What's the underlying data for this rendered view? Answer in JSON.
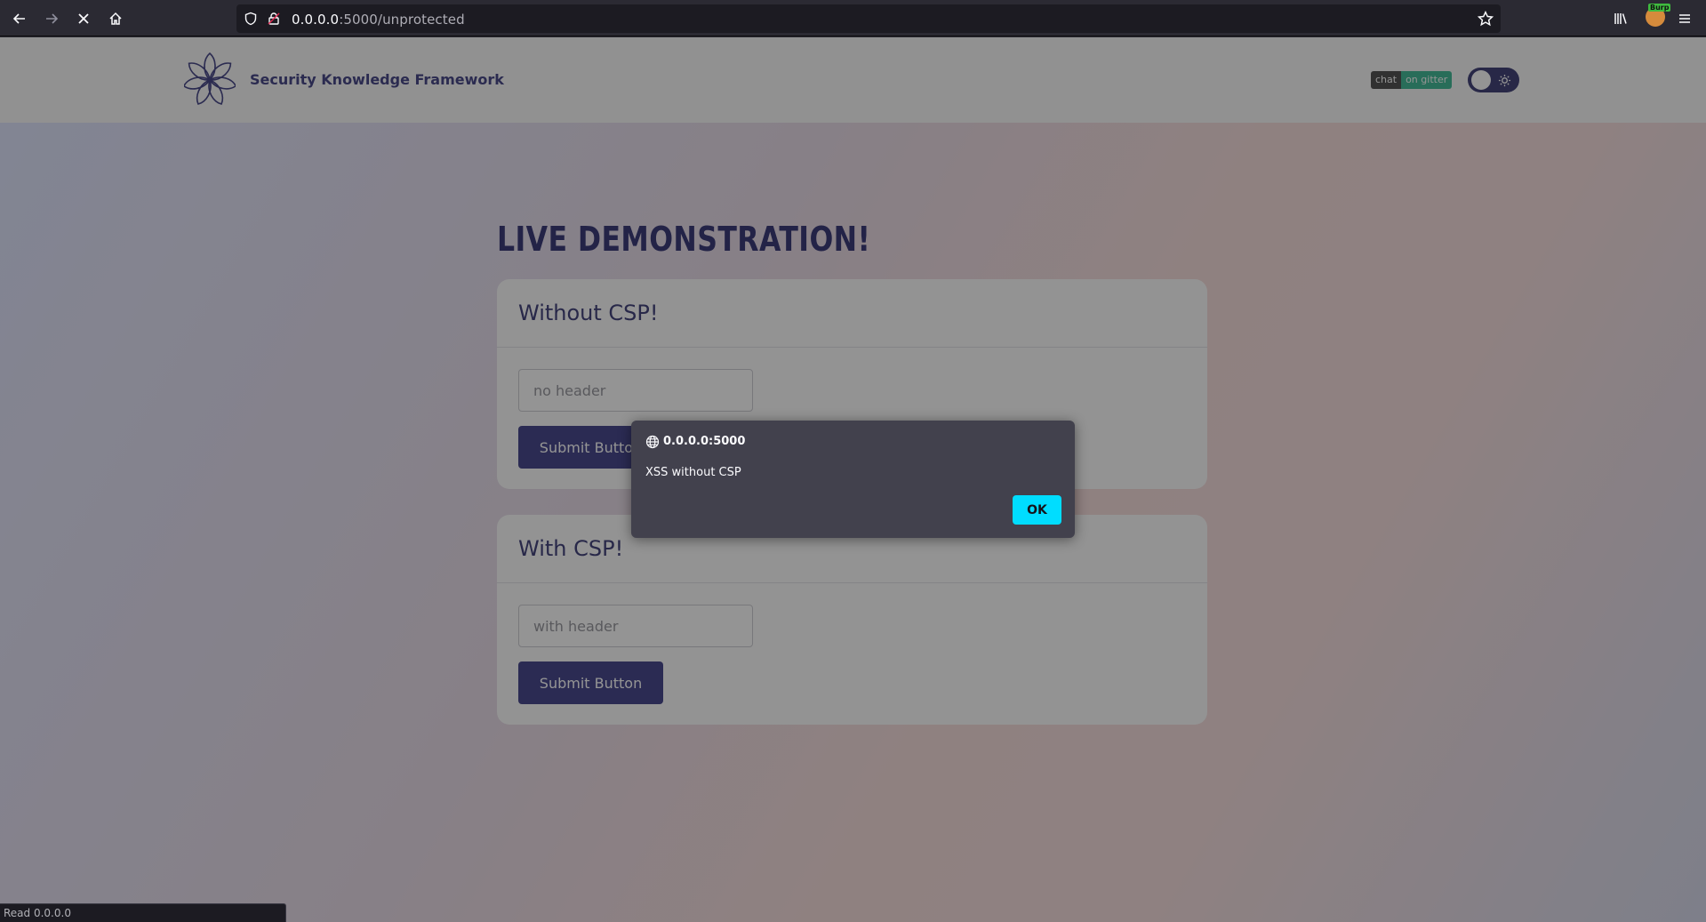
{
  "browser": {
    "url_host": "0.0.0.0",
    "url_rest": ":5000/unprotected",
    "ext_badge": "Burp",
    "status_text": "Read 0.0.0.0"
  },
  "header": {
    "brand": "Security Knowledge Framework",
    "gitter_left": "chat",
    "gitter_right": "on gitter"
  },
  "main": {
    "headline": "LIVE DEMONSTRATION!",
    "cards": [
      {
        "title": "Without CSP!",
        "placeholder": "no header",
        "button": "Submit Button"
      },
      {
        "title": "With CSP!",
        "placeholder": "with header",
        "button": "Submit Button"
      }
    ]
  },
  "modal": {
    "origin": "0.0.0.0:5000",
    "message": "XSS without CSP",
    "ok_label": "OK"
  },
  "colors": {
    "brand": "#4a4a8a",
    "button": "#4b4b8f",
    "modal_bg": "#42414d",
    "ok_button": "#00ddff"
  }
}
